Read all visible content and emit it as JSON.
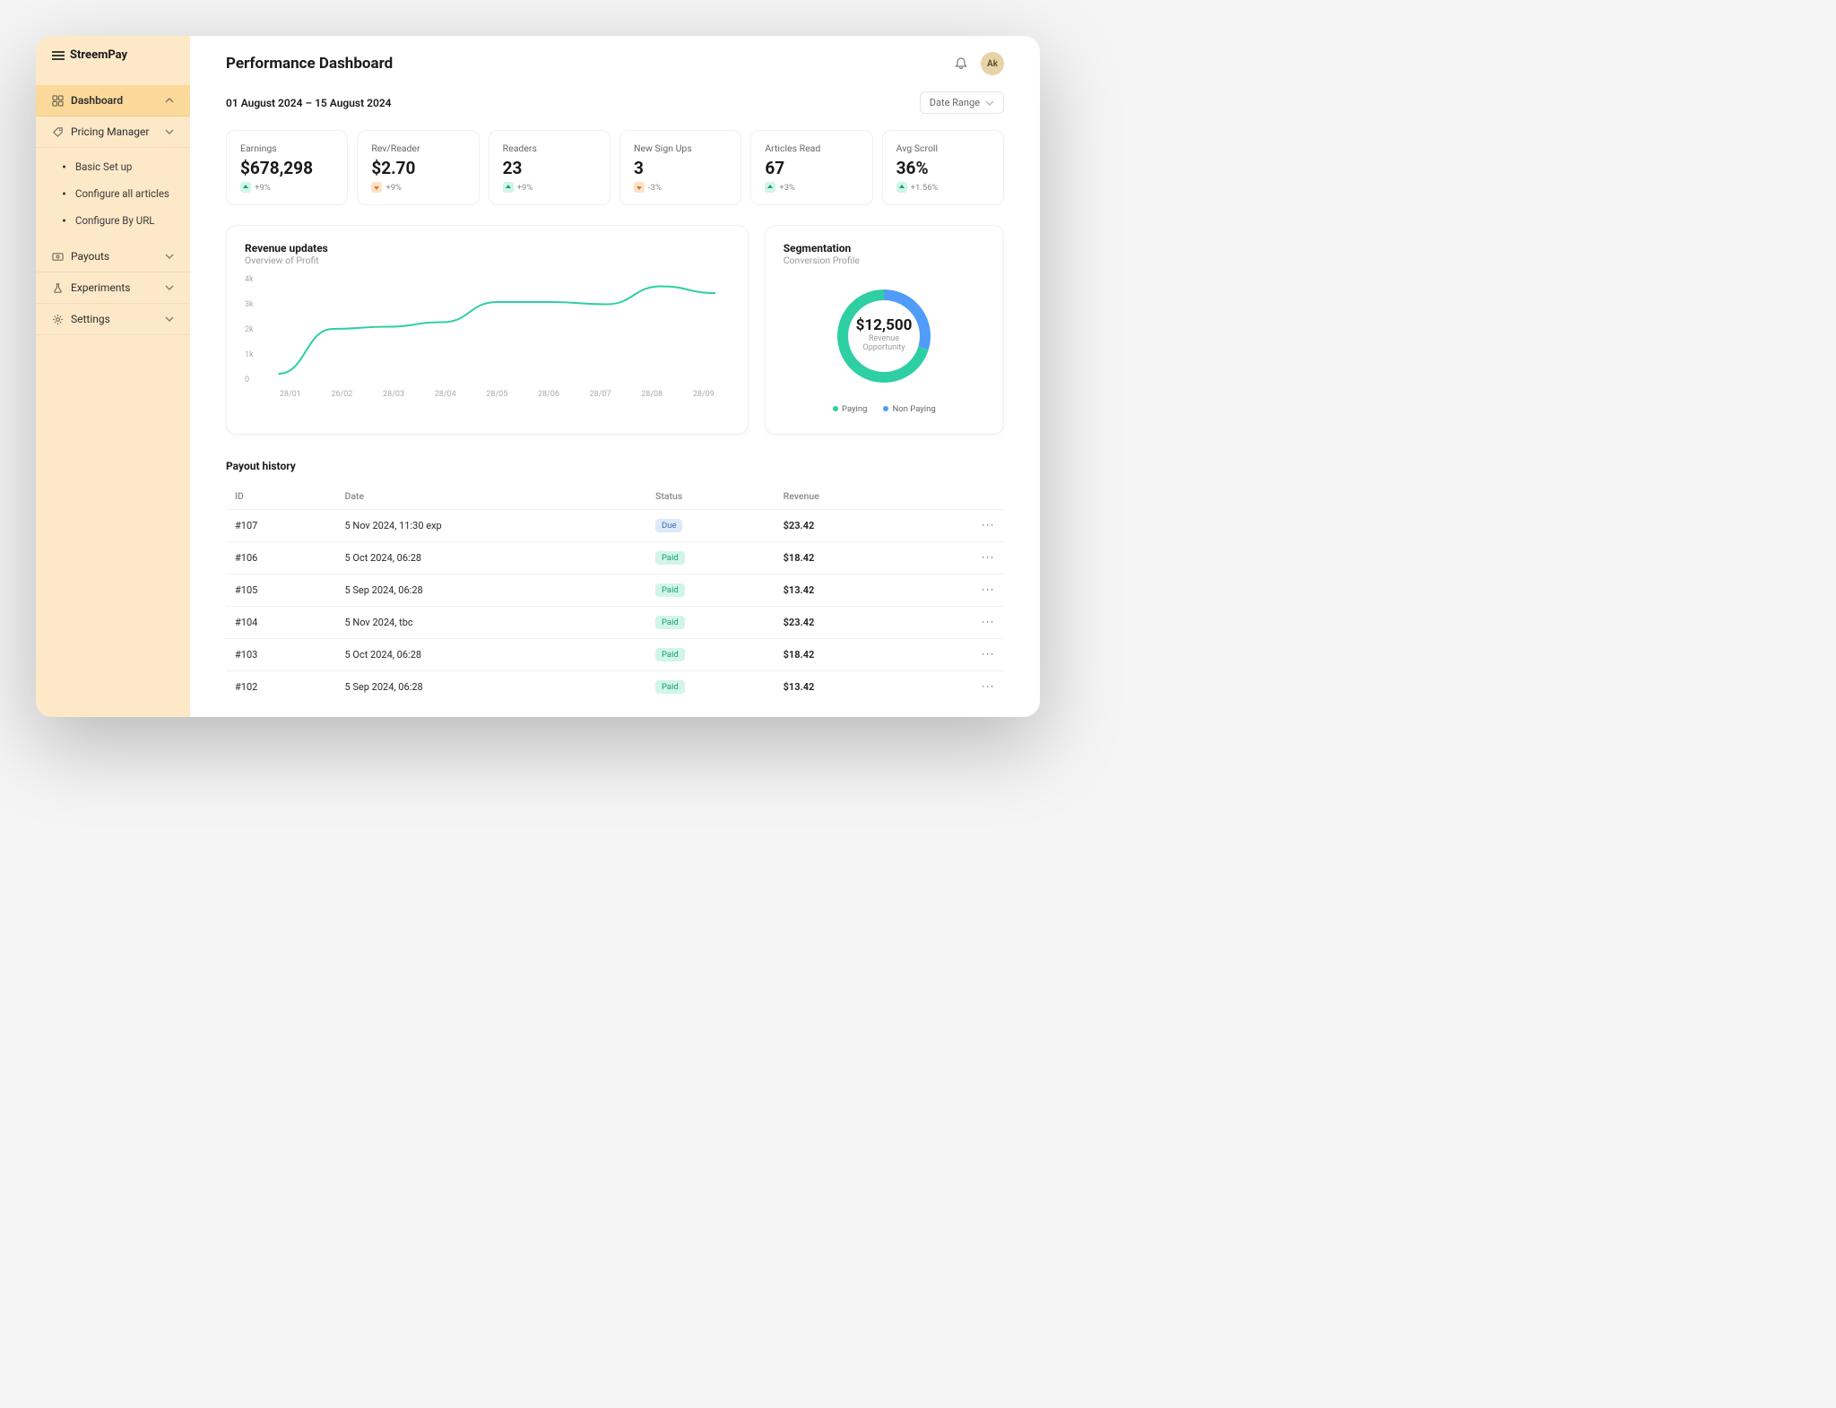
{
  "brand": "StreemPay",
  "sidebar": {
    "dashboard": "Dashboard",
    "pricing_manager": "Pricing Manager",
    "pm_items": [
      "Basic Set up",
      "Configure all articles",
      "Configure By URL"
    ],
    "payouts": "Payouts",
    "experiments": "Experiments",
    "settings": "Settings"
  },
  "header": {
    "title": "Performance Dashboard",
    "avatar": "Ak"
  },
  "date": {
    "range": "01 August 2024 – 15 August 2024",
    "picker_label": "Date Range"
  },
  "kpis": [
    {
      "label": "Earnings",
      "value": "$678,298",
      "delta": "+9%",
      "dir": "up"
    },
    {
      "label": "Rev/Reader",
      "value": "$2.70",
      "delta": "+9%",
      "dir": "down"
    },
    {
      "label": "Readers",
      "value": "23",
      "delta": "+9%",
      "dir": "up"
    },
    {
      "label": "New Sign Ups",
      "value": "3",
      "delta": "-3%",
      "dir": "down"
    },
    {
      "label": "Articles Read",
      "value": "67",
      "delta": "+3%",
      "dir": "up"
    },
    {
      "label": "Avg Scroll",
      "value": "36%",
      "delta": "+1.56%",
      "dir": "up"
    }
  ],
  "revenue_panel": {
    "title": "Revenue updates",
    "subtitle": "Overview of Profit"
  },
  "segmentation": {
    "title": "Segmentation",
    "subtitle": "Conversion Profile",
    "center_value": "$12,500",
    "center_label": "Revenue Opportunity",
    "legend_paying": "Paying",
    "legend_nonpaying": "Non Paying"
  },
  "chart_data": [
    {
      "type": "line",
      "title": "Revenue updates",
      "ylabel": "",
      "xlabel": "",
      "ylim": [
        0,
        4000
      ],
      "y_ticks": [
        "4k",
        "3k",
        "2k",
        "1k",
        "0"
      ],
      "x_ticks": [
        "28/01",
        "26/02",
        "28/03",
        "28/04",
        "28/05",
        "28/06",
        "28/07",
        "28/08",
        "28/09"
      ],
      "series": [
        {
          "name": "Profit",
          "x": [
            "28/01",
            "26/02",
            "28/03",
            "28/04",
            "28/05",
            "28/06",
            "28/07",
            "28/08",
            "28/09"
          ],
          "values": [
            0,
            2000,
            2100,
            2300,
            3200,
            3200,
            3100,
            3900,
            3600
          ]
        }
      ]
    },
    {
      "type": "pie",
      "title": "Segmentation",
      "center_value": "$12,500",
      "series": [
        {
          "name": "Paying",
          "value": 70,
          "color": "#2ecfa3"
        },
        {
          "name": "Non Paying",
          "value": 30,
          "color": "#4f9cf9"
        }
      ]
    }
  ],
  "payout": {
    "title": "Payout history",
    "headers": {
      "id": "ID",
      "date": "Date",
      "status": "Status",
      "revenue": "Revenue"
    },
    "rows": [
      {
        "id": "#107",
        "date": "5 Nov 2024, 11:30 exp",
        "status": "Due",
        "revenue": "$23.42"
      },
      {
        "id": "#106",
        "date": "5 Oct 2024, 06:28",
        "status": "Paid",
        "revenue": "$18.42"
      },
      {
        "id": "#105",
        "date": "5 Sep 2024, 06:28",
        "status": "Paid",
        "revenue": "$13.42"
      },
      {
        "id": "#104",
        "date": "5 Nov 2024, tbc",
        "status": "Paid",
        "revenue": "$23.42"
      },
      {
        "id": "#103",
        "date": "5 Oct 2024, 06:28",
        "status": "Paid",
        "revenue": "$18.42"
      },
      {
        "id": "#102",
        "date": "5 Sep 2024, 06:28",
        "status": "Paid",
        "revenue": "$13.42"
      }
    ]
  }
}
